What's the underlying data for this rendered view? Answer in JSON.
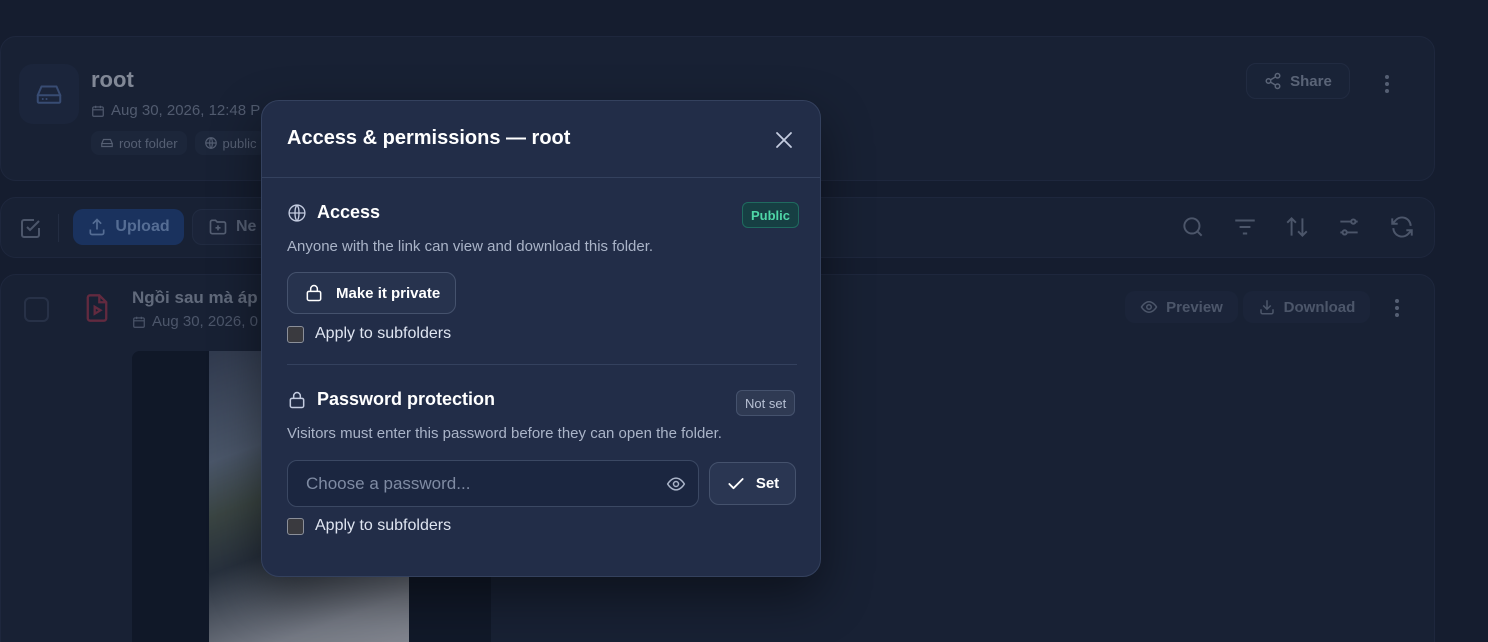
{
  "header": {
    "title": "root",
    "date": "Aug 30, 2026, 12:48 P",
    "chips": [
      "root folder",
      "public"
    ],
    "share_label": "Share"
  },
  "toolbar": {
    "upload_label": "Upload",
    "new_label": "Ne"
  },
  "file_row": {
    "name": "Ngồi sau mà áp",
    "date": "Aug 30, 2026, 0",
    "preview_label": "Preview",
    "download_label": "Download"
  },
  "modal": {
    "title": "Access & permissions — root",
    "access": {
      "title": "Access",
      "badge": "Public",
      "description": "Anyone with the link can view and download this folder.",
      "button_label": "Make it private",
      "apply_label": "Apply to subfolders"
    },
    "password": {
      "title": "Password protection",
      "badge": "Not set",
      "description": "Visitors must enter this password before they can open the folder.",
      "placeholder": "Choose a password...",
      "value": "",
      "set_label": "Set",
      "apply_label": "Apply to subfolders"
    }
  },
  "colors": {
    "background": "#1b2438",
    "modal_bg": "#222d48",
    "public_badge": "#4fd6a7",
    "upload_accent": "#234a8c"
  }
}
